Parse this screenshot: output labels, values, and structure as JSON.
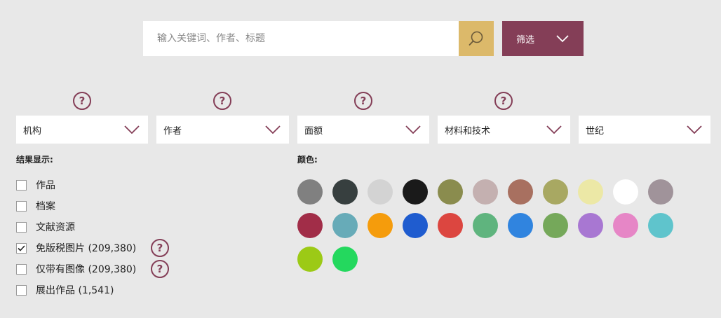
{
  "search": {
    "placeholder": "输入关键词、作者、标题"
  },
  "filter_button": {
    "label": "筛选"
  },
  "dropdowns": [
    {
      "label": "机构"
    },
    {
      "label": "作者"
    },
    {
      "label": "面额"
    },
    {
      "label": "材料和技术"
    },
    {
      "label": "世纪"
    }
  ],
  "help_icon_glyph": "?",
  "results": {
    "label": "结果显示:",
    "options": [
      {
        "label": "作品",
        "checked": false
      },
      {
        "label": "档案",
        "checked": false
      },
      {
        "label": "文献资源",
        "checked": false
      },
      {
        "label": "免版税图片 (209,380)",
        "checked": true
      },
      {
        "label": "仅带有图像 (209,380)",
        "checked": false
      },
      {
        "label": "展出作品 (1,541)",
        "checked": false
      }
    ]
  },
  "colors": {
    "label": "颜色:",
    "swatches": [
      "#808080",
      "#373f3f",
      "#d3d3d3",
      "#1a1a1a",
      "#8a8c4e",
      "#c4b0b0",
      "#a87060",
      "#a8a862",
      "#ece8a6",
      "#ffffff",
      "#a0939a",
      "#a12d48",
      "#67abb8",
      "#f59c0c",
      "#1f5ccf",
      "#dc4640",
      "#5fb47e",
      "#3084df",
      "#75a85a",
      "#a877d2",
      "#e686c6",
      "#5fc4cc",
      "#9cca16",
      "#24d85e"
    ]
  },
  "icons": {
    "search": "search-icon",
    "filter_chevron": "chevron-down-icon",
    "dropdown_chevron": "chevron-down-icon",
    "help": "help-icon",
    "check": "checkmark-icon"
  },
  "theme": {
    "accent": "#843e57",
    "search_button": "#dcb96a",
    "background": "#e8e8e8"
  }
}
